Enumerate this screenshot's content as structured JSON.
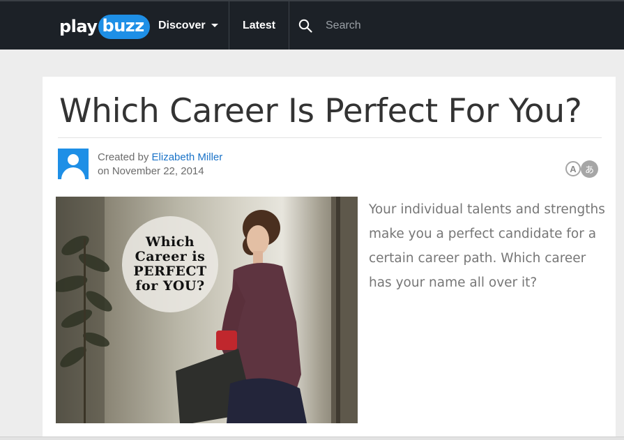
{
  "nav": {
    "logo_play": "play",
    "logo_buzz": "buzz",
    "discover_label": "Discover",
    "latest_label": "Latest",
    "search_placeholder": "Search"
  },
  "article": {
    "title": "Which Career Is Perfect For You?",
    "created_by_prefix": "Created by ",
    "author": "Elizabeth Miller",
    "date_line": "on November 22, 2014",
    "description": "Your individual talents and strengths make you a perfect candidate for a certain career path. Which career has your name all over it?",
    "hero_badge": {
      "line1": "Which",
      "line2": "Career is",
      "line3": "PERFECT",
      "line4": "for YOU?"
    },
    "language_icon_latin": "A",
    "language_icon_kana": "あ"
  },
  "colors": {
    "nav_bg": "#1c2127",
    "brand_blue": "#1e8fe6",
    "link_blue": "#1a73c8",
    "page_bg": "#ededed"
  },
  "icons": [
    "search-icon",
    "chevron-down-icon",
    "avatar-icon",
    "translate-icon"
  ]
}
